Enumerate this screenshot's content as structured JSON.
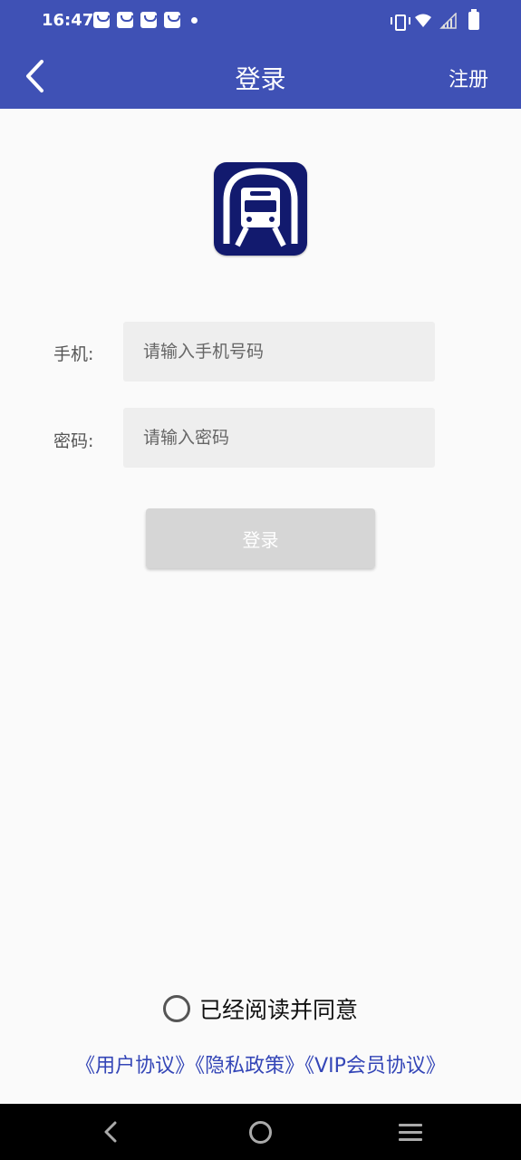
{
  "status_bar": {
    "time": "16:47",
    "icons": [
      "notification-bag-icon",
      "notification-bag-icon",
      "notification-bag-icon",
      "notification-bag-icon",
      "dot-icon",
      "vibrate-icon",
      "wifi-icon",
      "signal-icon",
      "battery-icon"
    ]
  },
  "app_bar": {
    "title": "登录",
    "register_label": "注册",
    "background": "#3f51b5"
  },
  "form": {
    "phone": {
      "label": "手机:",
      "placeholder": "请输入手机号码",
      "value": ""
    },
    "password": {
      "label": "密码:",
      "placeholder": "请输入密码",
      "value": ""
    },
    "login_button": "登录"
  },
  "agreement": {
    "checked": false,
    "text": "已经阅读并同意",
    "links": [
      "《用户协议》",
      "《隐私政策》",
      "《VIP会员协议》"
    ],
    "link_color": "#3446b7"
  },
  "nav_bar": {
    "icons": [
      "back-icon",
      "home-icon",
      "menu-icon"
    ]
  }
}
